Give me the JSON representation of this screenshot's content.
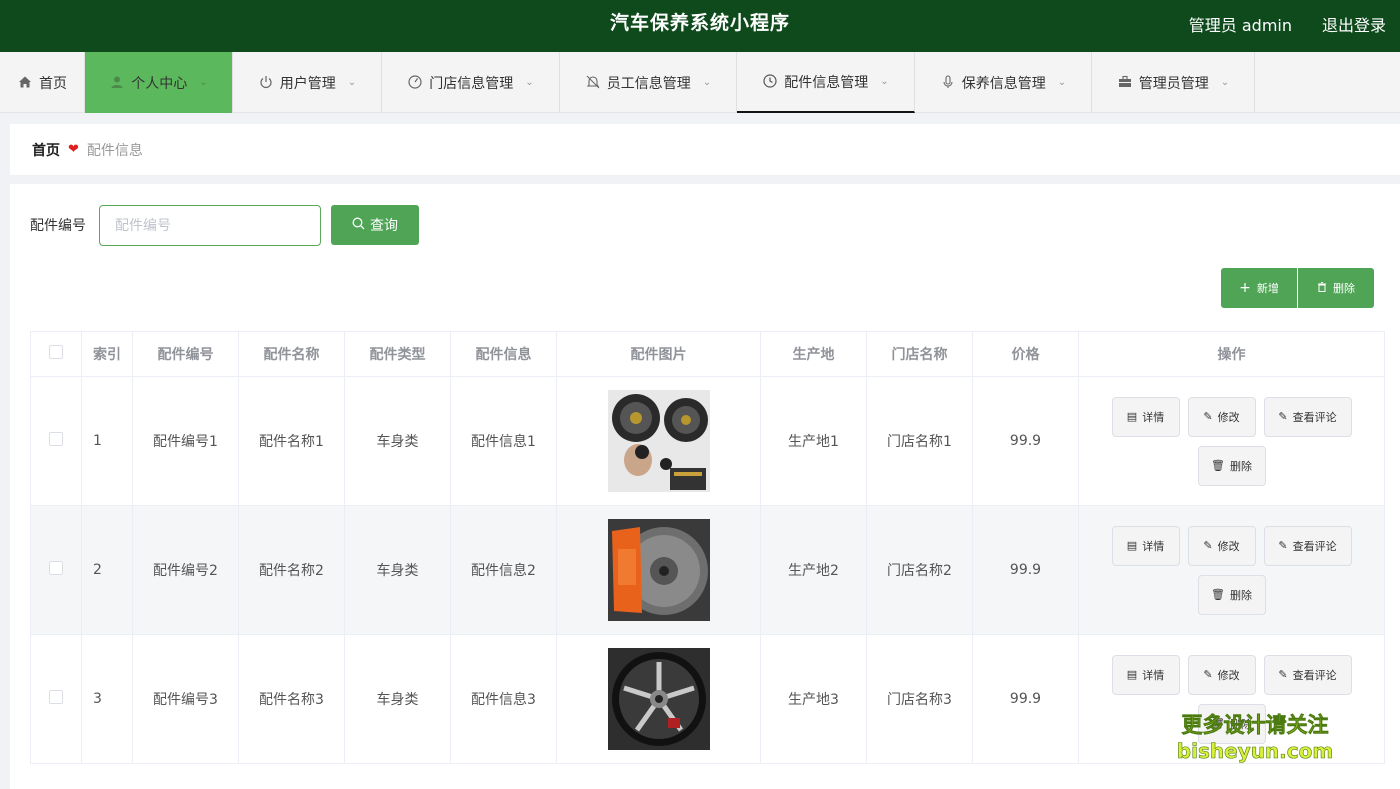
{
  "header": {
    "title": "汽车保养系统小程序",
    "user": "管理员 admin",
    "logout": "退出登录"
  },
  "nav": {
    "items": [
      {
        "label": "首页",
        "icon": "home-icon"
      },
      {
        "label": "个人中心",
        "icon": "user-icon"
      },
      {
        "label": "用户管理",
        "icon": "power-icon"
      },
      {
        "label": "门店信息管理",
        "icon": "gauge-icon"
      },
      {
        "label": "员工信息管理",
        "icon": "bell-off-icon"
      },
      {
        "label": "配件信息管理",
        "icon": "clock-icon"
      },
      {
        "label": "保养信息管理",
        "icon": "mic-icon"
      },
      {
        "label": "管理员管理",
        "icon": "briefcase-icon"
      }
    ],
    "active": "个人中心",
    "current": "配件信息管理"
  },
  "breadcrumb": {
    "home": "首页",
    "current": "配件信息"
  },
  "search": {
    "label": "配件编号",
    "placeholder": "配件编号",
    "button": "查询"
  },
  "toolbar": {
    "add": "新增",
    "delete": "删除"
  },
  "table": {
    "columns": [
      "索引",
      "配件编号",
      "配件名称",
      "配件类型",
      "配件信息",
      "配件图片",
      "生产地",
      "门店名称",
      "价格",
      "操作"
    ],
    "rows": [
      {
        "index": "1",
        "code": "配件编号1",
        "name": "配件名称1",
        "type": "车身类",
        "info": "配件信息1",
        "image": "speaker-parts-photo",
        "origin": "生产地1",
        "store": "门店名称1",
        "price": "99.9"
      },
      {
        "index": "2",
        "code": "配件编号2",
        "name": "配件名称2",
        "type": "车身类",
        "info": "配件信息2",
        "image": "brake-caliper-photo",
        "origin": "生产地2",
        "store": "门店名称2",
        "price": "99.9"
      },
      {
        "index": "3",
        "code": "配件编号3",
        "name": "配件名称3",
        "type": "车身类",
        "info": "配件信息3",
        "image": "alloy-wheel-photo",
        "origin": "生产地3",
        "store": "门店名称3",
        "price": "99.9"
      }
    ],
    "actions": {
      "detail": "详情",
      "edit": "修改",
      "review": "查看评论",
      "delete": "删除"
    }
  },
  "watermark": {
    "line1": "更多设计请关注",
    "line2": "bisheyun.com"
  },
  "colors": {
    "header_bg": "#0f4a1d",
    "accent": "#4fa456",
    "nav_active": "#5cb85c"
  }
}
